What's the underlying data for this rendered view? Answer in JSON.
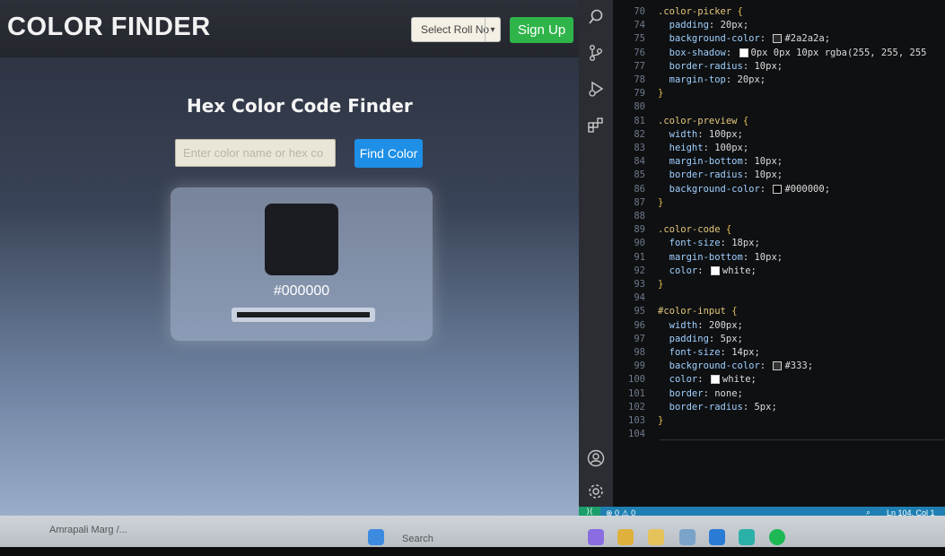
{
  "app": {
    "brand": "COLOR FINDER",
    "roll_select": "Select Roll No",
    "signup_label": "Sign Up",
    "title": "Hex Color Code Finder",
    "input_placeholder": "Enter color name or hex co",
    "find_label": "Find Color",
    "color_code": "#000000",
    "preview_color": "#1b1c22"
  },
  "editor": {
    "lines": [
      {
        "n": "70",
        "t": ".color-picker {"
      },
      {
        "n": "74",
        "t": "  padding: 20px;"
      },
      {
        "n": "75",
        "t": "  background-color: #2a2a2a;"
      },
      {
        "n": "76",
        "t": "  box-shadow: 0px 0px 10px rgba(255, 255, 255"
      },
      {
        "n": "77",
        "t": "  border-radius: 10px;"
      },
      {
        "n": "78",
        "t": "  margin-top: 20px;"
      },
      {
        "n": "79",
        "t": "}"
      },
      {
        "n": "80",
        "t": ""
      },
      {
        "n": "81",
        "t": ".color-preview {"
      },
      {
        "n": "82",
        "t": "  width: 100px;"
      },
      {
        "n": "83",
        "t": "  height: 100px;"
      },
      {
        "n": "84",
        "t": "  margin-bottom: 10px;"
      },
      {
        "n": "85",
        "t": "  border-radius: 10px;"
      },
      {
        "n": "86",
        "t": "  background-color: #000000;"
      },
      {
        "n": "87",
        "t": "}"
      },
      {
        "n": "88",
        "t": ""
      },
      {
        "n": "89",
        "t": ".color-code {"
      },
      {
        "n": "90",
        "t": "  font-size: 18px;"
      },
      {
        "n": "91",
        "t": "  margin-bottom: 10px;"
      },
      {
        "n": "92",
        "t": "  color: white;"
      },
      {
        "n": "93",
        "t": "}"
      },
      {
        "n": "94",
        "t": ""
      },
      {
        "n": "95",
        "t": "#color-input {"
      },
      {
        "n": "96",
        "t": "  width: 200px;"
      },
      {
        "n": "97",
        "t": "  padding: 5px;"
      },
      {
        "n": "98",
        "t": "  font-size: 14px;"
      },
      {
        "n": "99",
        "t": "  background-color: #333;"
      },
      {
        "n": "100",
        "t": "  color: white;"
      },
      {
        "n": "101",
        "t": "  border: none;"
      },
      {
        "n": "102",
        "t": "  border-radius: 5px;"
      },
      {
        "n": "103",
        "t": "}"
      },
      {
        "n": "104",
        "t": ""
      }
    ],
    "swatches": {
      "75": "#2a2a2a",
      "76": "#ffffff",
      "86": "#000000",
      "92": "#ffffff",
      "99": "#333333",
      "100": "#ffffff"
    }
  },
  "status": {
    "problems": "⊗ 0 ⚠ 0",
    "position": "Ln 104, Col 1"
  },
  "taskbar": {
    "window_label": "Amrapali Marg /...",
    "search_label": "Search"
  }
}
